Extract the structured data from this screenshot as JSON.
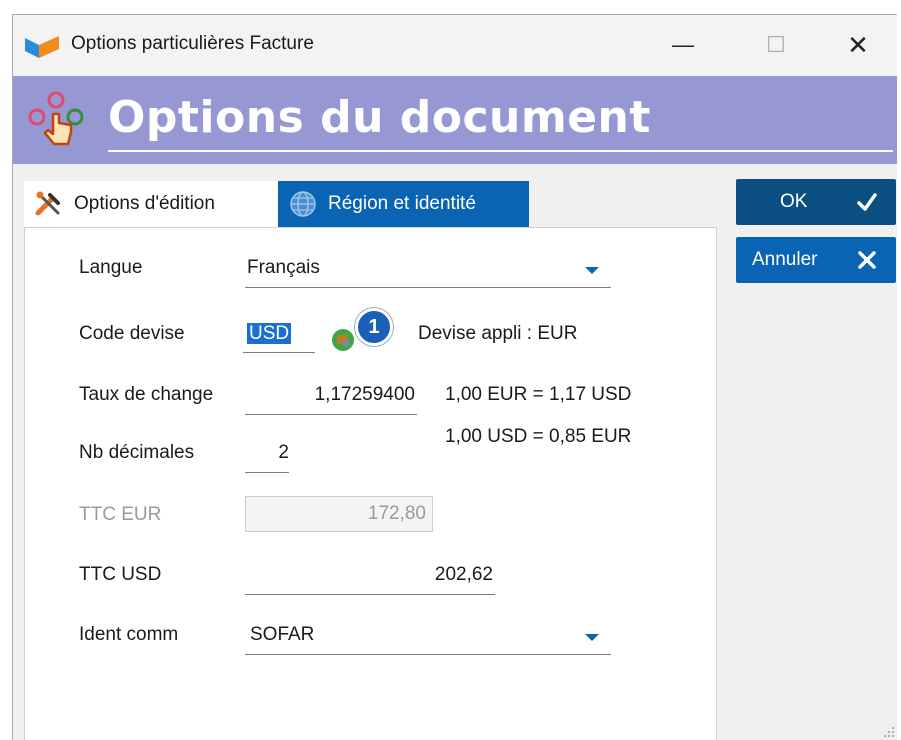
{
  "window": {
    "title": "Options particulières Facture"
  },
  "header": {
    "title": "Options du document"
  },
  "tabs": [
    {
      "label": "Options d'édition",
      "active": true
    },
    {
      "label": "Région et identité",
      "active": false
    }
  ],
  "form": {
    "langue": {
      "label": "Langue",
      "value": "Français"
    },
    "code_devise": {
      "label": "Code devise",
      "value": "USD",
      "badge": "1",
      "info": "Devise appli : EUR"
    },
    "taux": {
      "label": "Taux de change",
      "value": "1,17259400",
      "conv1": "1,00 EUR = 1,17 USD",
      "conv2": "1,00 USD = 0,85 EUR"
    },
    "decimales": {
      "label": "Nb décimales",
      "value": "2"
    },
    "ttc_eur": {
      "label": "TTC EUR",
      "value": "172,80"
    },
    "ttc_usd": {
      "label": "TTC USD",
      "value": "202,62"
    },
    "ident": {
      "label": "Ident comm",
      "value": "SOFAR"
    }
  },
  "buttons": {
    "ok": "OK",
    "cancel": "Annuler"
  },
  "colors": {
    "header_bg": "#9698d4",
    "active_blue": "#0a64b4",
    "ok_bg": "#0b4f82"
  }
}
